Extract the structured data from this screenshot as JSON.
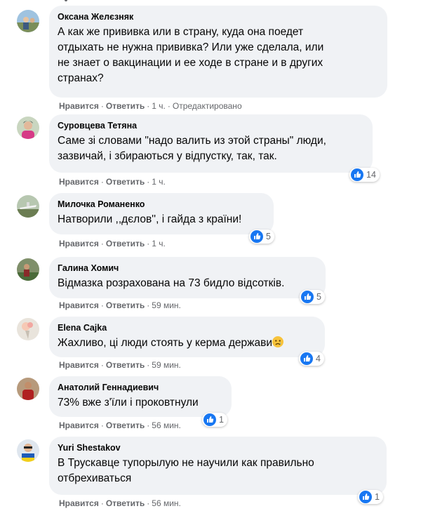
{
  "actions": {
    "like": "Нравится",
    "reply": "Ответить",
    "edited": "Отредактировано",
    "separator": "·"
  },
  "colors": {
    "bubble": "#f0f2f5",
    "meta": "#65676b",
    "like_blue": "#1877f2"
  },
  "comments": [
    {
      "author": "Оксана Желєзняк",
      "text": "А как же прививка или в страну, куда она поедет\nотдыхать не нужна прививка? Или уже сделала, или\nне знает о вакцинации и ее ходе в стране и в других\nстранах?",
      "time": "1 ч.",
      "reactions": null
    },
    {
      "author": "Суровцева Тетяна",
      "text": "Саме зі словами \"надо валить из этой страны\" люди,\nзазвичай, і збираються у відпустку, так, так.",
      "time": "1 ч.",
      "reactions": "14"
    },
    {
      "author": "Милочка Романенко",
      "text": "Натворили ,,дєлов'', і гайда з країни!",
      "time": "1 ч.",
      "reactions": "5"
    },
    {
      "author": "Галина Хомич",
      "text": "Відмазка розрахована на 73 бидло відсотків.",
      "time": "59 мин.",
      "reactions": "5"
    },
    {
      "author": "Elena Cajka",
      "text": "Жахливо, ці люди стоять у керма держави",
      "emoji": "sad-face-icon",
      "time": "59 мин.",
      "reactions": "4"
    },
    {
      "author": "Анатолий Геннадиевич",
      "text": "73% вже з'їли і проковтнули",
      "time": "56 мин.",
      "reactions": "1"
    },
    {
      "author": "Yuri Shestakov",
      "text": "В Трускавце тупорылую не научили как правильно\nотбрехиваться",
      "time": "56 мин.",
      "reactions": "1"
    }
  ]
}
